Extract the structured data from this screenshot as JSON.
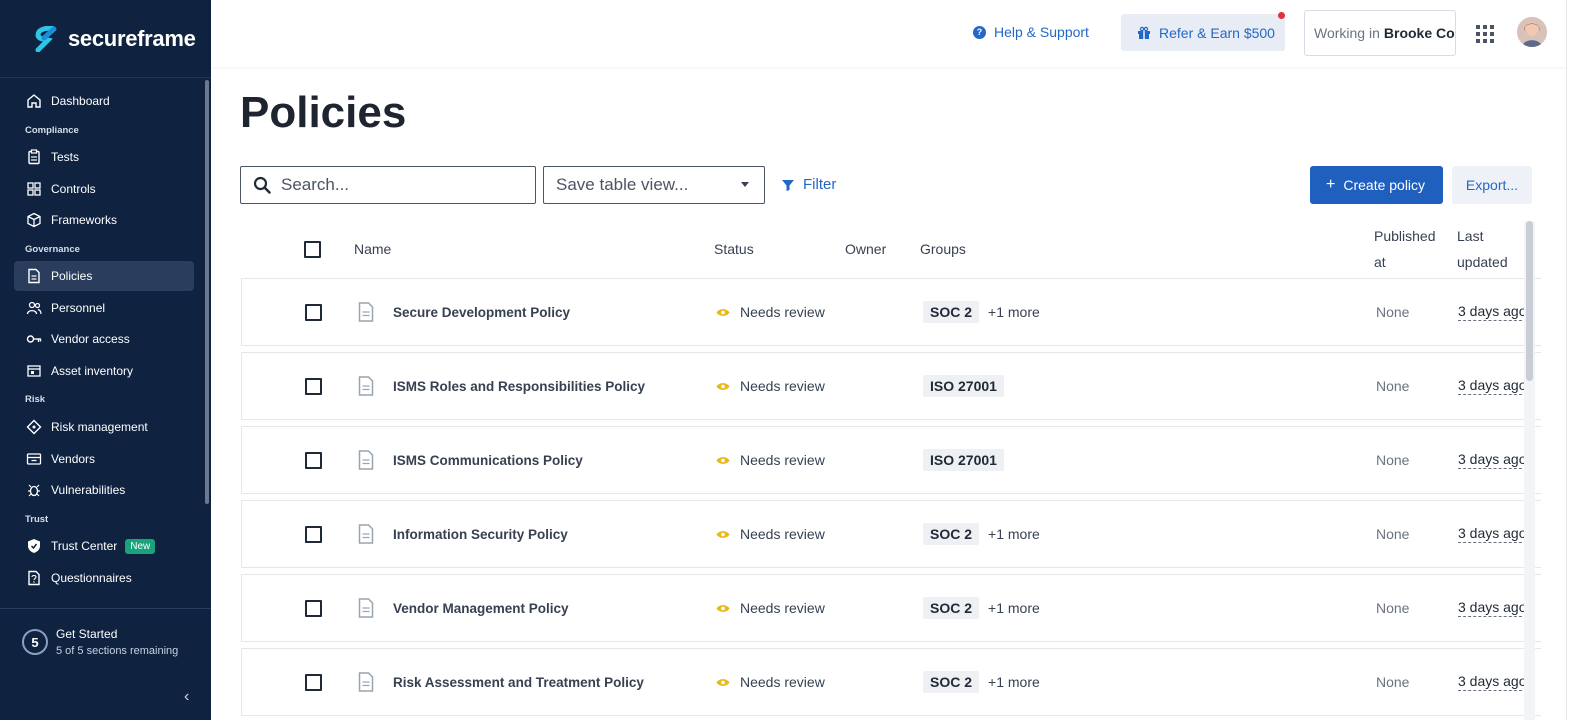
{
  "brand": {
    "name": "secureframe"
  },
  "sidebar": {
    "items": [
      {
        "type": "item",
        "label": "Dashboard",
        "icon": "home-icon"
      },
      {
        "type": "section",
        "label": "Compliance"
      },
      {
        "type": "item",
        "label": "Tests",
        "icon": "clipboard-icon"
      },
      {
        "type": "item",
        "label": "Controls",
        "icon": "controls-icon"
      },
      {
        "type": "item",
        "label": "Frameworks",
        "icon": "cube-icon"
      },
      {
        "type": "section",
        "label": "Governance"
      },
      {
        "type": "item",
        "label": "Policies",
        "icon": "document-icon",
        "active": true
      },
      {
        "type": "item",
        "label": "Personnel",
        "icon": "people-icon"
      },
      {
        "type": "item",
        "label": "Vendor access",
        "icon": "key-icon"
      },
      {
        "type": "item",
        "label": "Asset inventory",
        "icon": "inventory-icon"
      },
      {
        "type": "section",
        "label": "Risk"
      },
      {
        "type": "item",
        "label": "Risk management",
        "icon": "diamond-icon"
      },
      {
        "type": "item",
        "label": "Vendors",
        "icon": "vendors-icon"
      },
      {
        "type": "item",
        "label": "Vulnerabilities",
        "icon": "bug-icon"
      },
      {
        "type": "section",
        "label": "Trust"
      },
      {
        "type": "item",
        "label": "Trust Center",
        "icon": "shield-icon",
        "badge": "New"
      },
      {
        "type": "item",
        "label": "Questionnaires",
        "icon": "questionnaire-icon"
      }
    ],
    "get_started": {
      "count": "5",
      "title": "Get Started",
      "subtitle": "5 of 5 sections remaining"
    }
  },
  "topbar": {
    "help_label": "Help & Support",
    "refer_label": "Refer & Earn $500",
    "workspace_prefix": "Working in",
    "workspace_name": "Brooke Co"
  },
  "main": {
    "title": "Policies",
    "search_placeholder": "Search...",
    "table_view_placeholder": "Save table view...",
    "filter_label": "Filter",
    "create_label": "Create policy",
    "export_label": "Export..."
  },
  "table": {
    "headers": {
      "name": "Name",
      "status": "Status",
      "owner": "Owner",
      "groups": "Groups",
      "published_line1": "Published",
      "published_line2": "at",
      "updated_line1": "Last",
      "updated_line2": "updated"
    },
    "rows": [
      {
        "name": "Secure Development Policy",
        "status": "Needs review",
        "group": "SOC 2",
        "more": "+1 more",
        "published": "None",
        "updated": "3 days ago"
      },
      {
        "name": "ISMS Roles and Responsibilities Policy",
        "status": "Needs review",
        "group": "ISO 27001",
        "more": "",
        "published": "None",
        "updated": "3 days ago"
      },
      {
        "name": "ISMS Communications Policy",
        "status": "Needs review",
        "group": "ISO 27001",
        "more": "",
        "published": "None",
        "updated": "3 days ago"
      },
      {
        "name": "Information Security Policy",
        "status": "Needs review",
        "group": "SOC 2",
        "more": "+1 more",
        "published": "None",
        "updated": "3 days ago"
      },
      {
        "name": "Vendor Management Policy",
        "status": "Needs review",
        "group": "SOC 2",
        "more": "+1 more",
        "published": "None",
        "updated": "3 days ago"
      },
      {
        "name": "Risk Assessment and Treatment Policy",
        "status": "Needs review",
        "group": "SOC 2",
        "more": "+1 more",
        "published": "None",
        "updated": "3 days ago"
      }
    ]
  },
  "colors": {
    "sidebar_bg": "#0f2240",
    "accent": "#1f5fbe",
    "status_warning": "#e8b820",
    "badge_new": "#1aa37a"
  }
}
